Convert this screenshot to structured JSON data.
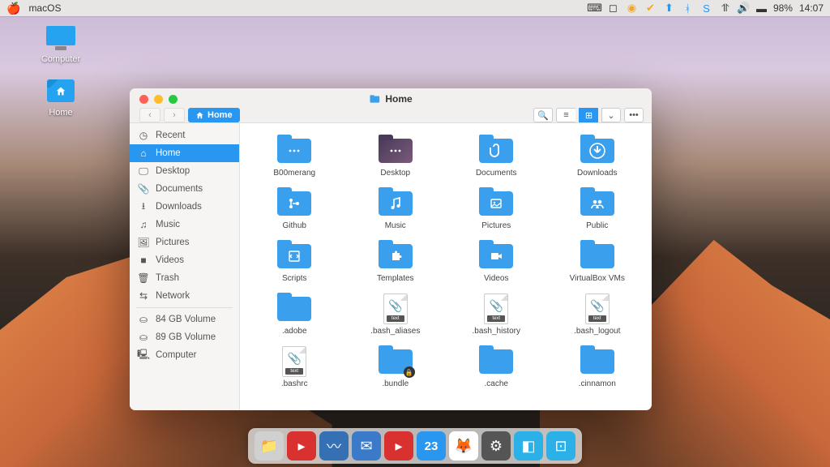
{
  "menubar": {
    "app_label": "macOS",
    "battery": "98%",
    "time": "14:07"
  },
  "desktop": {
    "computer_label": "Computer",
    "home_label": "Home"
  },
  "window": {
    "title": "Home",
    "path_label": "Home",
    "sidebar": {
      "items": [
        {
          "icon": "clock",
          "label": "Recent"
        },
        {
          "icon": "home",
          "label": "Home"
        },
        {
          "icon": "desktop",
          "label": "Desktop"
        },
        {
          "icon": "doc",
          "label": "Documents"
        },
        {
          "icon": "download",
          "label": "Downloads"
        },
        {
          "icon": "music",
          "label": "Music"
        },
        {
          "icon": "picture",
          "label": "Pictures"
        },
        {
          "icon": "video",
          "label": "Videos"
        },
        {
          "icon": "trash",
          "label": "Trash"
        },
        {
          "icon": "network",
          "label": "Network"
        }
      ],
      "volumes": [
        {
          "label": "84 GB Volume"
        },
        {
          "label": "89 GB Volume"
        },
        {
          "label": "Computer"
        }
      ]
    },
    "grid": [
      {
        "type": "folder",
        "glyph": "dots",
        "label": "B00merang"
      },
      {
        "type": "folder-dark",
        "glyph": "dots",
        "label": "Desktop"
      },
      {
        "type": "folder",
        "glyph": "clip",
        "label": "Documents"
      },
      {
        "type": "folder",
        "glyph": "down",
        "label": "Downloads"
      },
      {
        "type": "folder",
        "glyph": "git",
        "label": "Github"
      },
      {
        "type": "folder",
        "glyph": "music",
        "label": "Music"
      },
      {
        "type": "folder",
        "glyph": "pic",
        "label": "Pictures"
      },
      {
        "type": "folder",
        "glyph": "people",
        "label": "Public"
      },
      {
        "type": "folder",
        "glyph": "script",
        "label": "Scripts"
      },
      {
        "type": "folder",
        "glyph": "puzzle",
        "label": "Templates"
      },
      {
        "type": "folder",
        "glyph": "vid",
        "label": "Videos"
      },
      {
        "type": "folder",
        "glyph": "",
        "label": "VirtualBox VMs"
      },
      {
        "type": "folder",
        "glyph": "",
        "label": ".adobe"
      },
      {
        "type": "file",
        "tag": "text",
        "label": ".bash_aliases"
      },
      {
        "type": "file",
        "tag": "text",
        "label": ".bash_history"
      },
      {
        "type": "file",
        "tag": "text",
        "label": ".bash_logout"
      },
      {
        "type": "file",
        "tag": "text",
        "label": ".bashrc"
      },
      {
        "type": "folder",
        "glyph": "lock",
        "label": ".bundle"
      },
      {
        "type": "folder",
        "glyph": "",
        "label": ".cache"
      },
      {
        "type": "folder",
        "glyph": "",
        "label": ".cinnamon"
      }
    ]
  },
  "dock": {
    "calendar_day": "23"
  }
}
